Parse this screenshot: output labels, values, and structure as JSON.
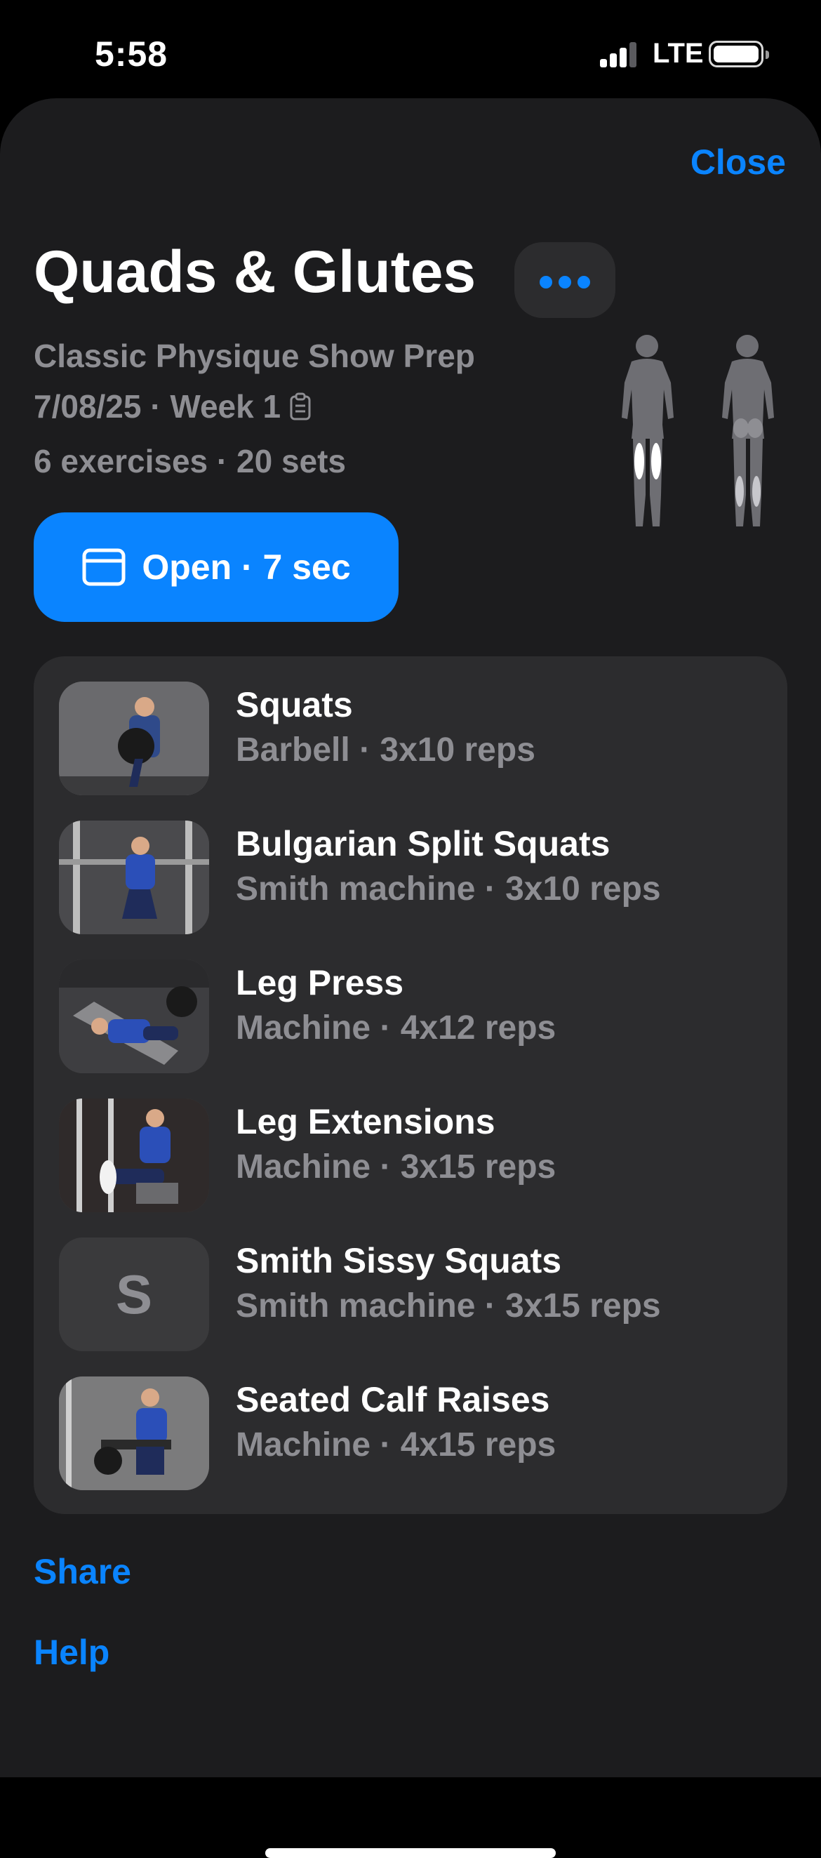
{
  "status_bar": {
    "time": "5:58",
    "network": "LTE"
  },
  "header": {
    "close_label": "Close",
    "title": "Quads & Glutes",
    "more_icon": "ellipsis-icon"
  },
  "workout": {
    "program": "Classic Physique Show Prep",
    "date_week": "7/08/25 · Week 1",
    "summary": "6 exercises · 20 sets"
  },
  "open_button": {
    "label": "Open · 7 sec",
    "icon": "window-icon"
  },
  "exercises": [
    {
      "name": "Squats",
      "detail": "Barbell · 3x10 reps"
    },
    {
      "name": "Bulgarian Split Squats",
      "detail": "Smith machine · 3x10 reps"
    },
    {
      "name": "Leg Press",
      "detail": "Machine · 4x12 reps"
    },
    {
      "name": "Leg Extensions",
      "detail": "Machine · 3x15 reps"
    },
    {
      "name": "Smith Sissy Squats",
      "detail": "Smith machine · 3x15 reps",
      "placeholder_letter": "S"
    },
    {
      "name": "Seated Calf Raises",
      "detail": "Machine · 4x15 reps"
    }
  ],
  "footer": {
    "share_label": "Share",
    "help_label": "Help"
  },
  "colors": {
    "accent": "#0a84ff",
    "sheet": "#1c1c1e",
    "card": "#2c2c2e",
    "secondary_text": "#8e8e93"
  }
}
